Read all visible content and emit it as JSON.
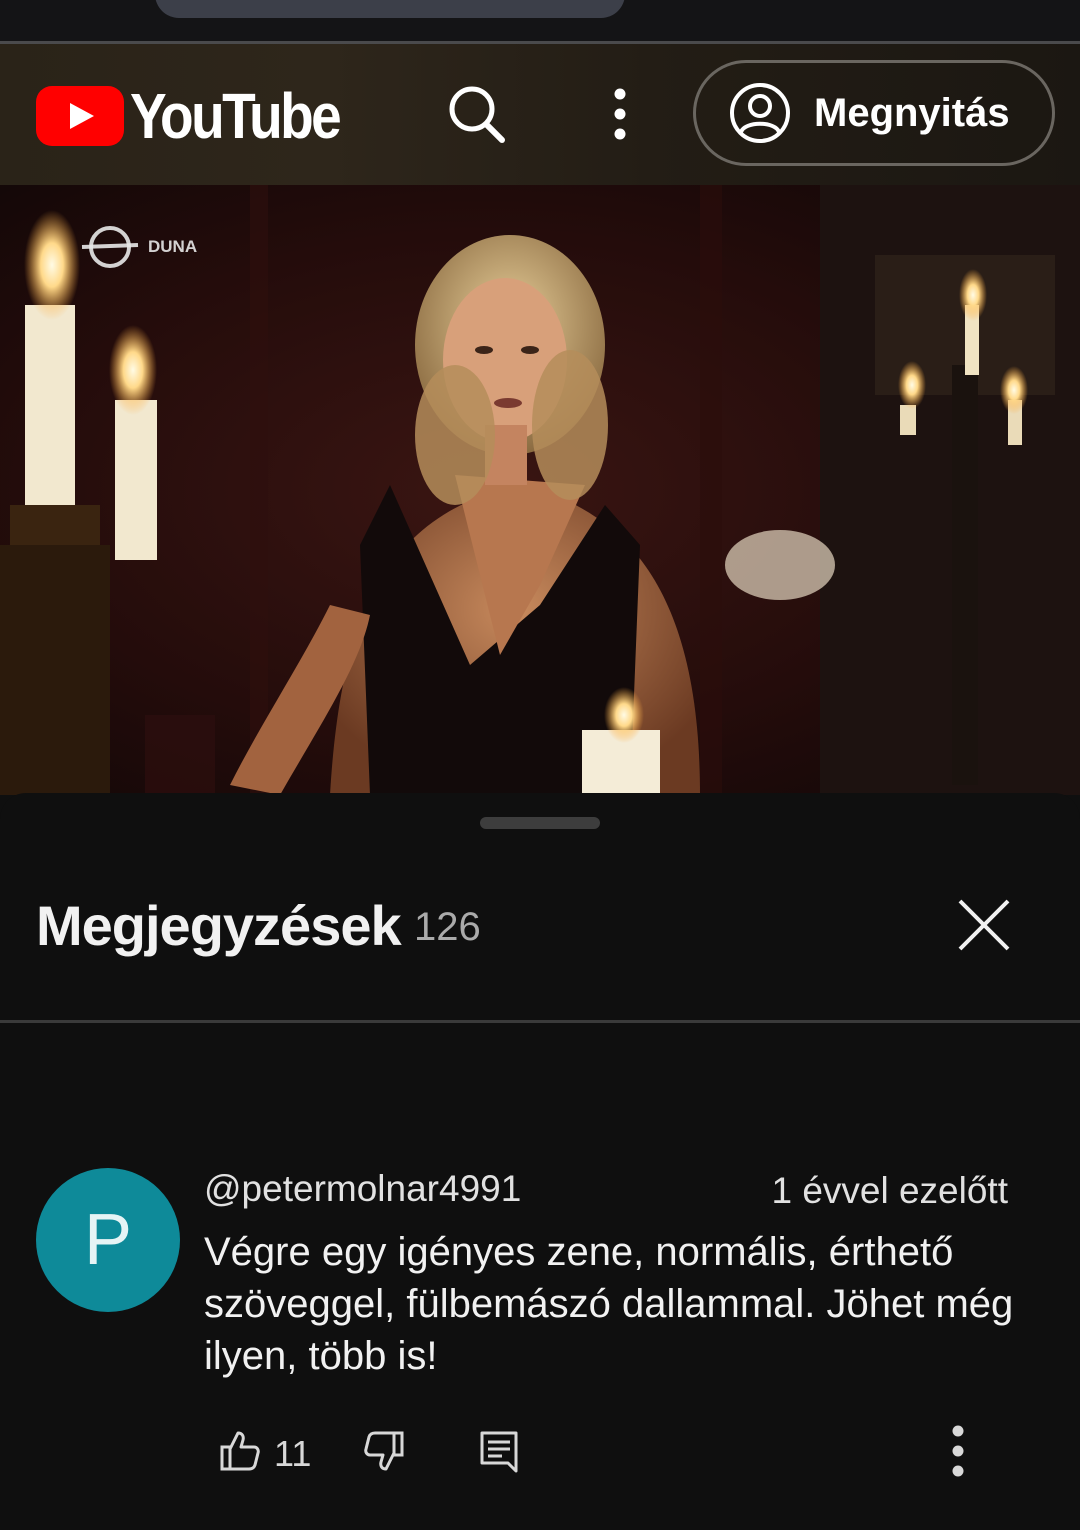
{
  "header": {
    "logo_text": "YouTube",
    "open_label": "Megnyitás",
    "icons": [
      "youtube-logo",
      "search-icon",
      "more-vert-icon",
      "account-icon"
    ]
  },
  "video": {
    "watermark": "DUNA"
  },
  "comments_panel": {
    "title": "Megjegyzések",
    "count": "126",
    "close_icon": "close-icon"
  },
  "comment": {
    "avatar_initial": "P",
    "avatar_color": "#0e8a99",
    "author": "@petermolnar4991",
    "time": "1 évvel ezelőtt",
    "text": "Végre egy igényes zene, normális, érthető szöveggel, fülbemászó dallammal. Jöhet még ilyen, több is!",
    "likes": "11",
    "icons": [
      "thumbs-up-icon",
      "thumbs-down-icon",
      "reply-icon",
      "more-vert-icon"
    ]
  },
  "colors": {
    "background": "#0f0f0f",
    "brand_red": "#ff0000",
    "text_primary": "#f1f1f1",
    "text_secondary": "#aaaaaa"
  }
}
